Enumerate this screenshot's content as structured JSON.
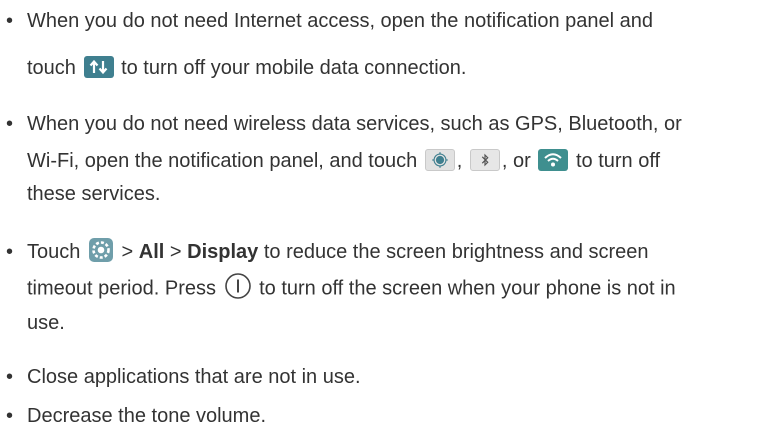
{
  "tips": [
    {
      "line1": "When you do not need Internet access, open the notification panel and",
      "line2_before": "touch",
      "line2_after": "to turn off your mobile data connection."
    },
    {
      "line1": "When you do not need wireless data services, such as GPS, Bluetooth, or",
      "line2_before": "Wi-Fi, open the notification panel, and touch",
      "line2_sep1": ",",
      "line2_sep2": ", or",
      "line2_after": "to turn off",
      "line3": "these services."
    },
    {
      "line1_before": "Touch",
      "line1_sep1": ">",
      "line1_all": "All",
      "line1_sep2": ">",
      "line1_display": "Display",
      "line1_after": "to reduce the screen brightness and screen",
      "line2_before": "timeout period. Press",
      "line2_after": "to turn off the screen when your phone is not in",
      "line3": "use."
    },
    {
      "line1": "Close applications that are not in use."
    },
    {
      "line1": "Decrease the tone volume."
    }
  ],
  "bullet_char": "•",
  "icons": {
    "mobile_data": "mobile-data-toggle-icon",
    "gps": "gps-toggle-icon",
    "bluetooth": "bluetooth-toggle-icon",
    "wifi": "wifi-toggle-icon",
    "settings": "settings-gear-icon",
    "power": "power-key-icon"
  },
  "colors": {
    "text": "#333333",
    "data_icon_bg": "#3f7f8f",
    "wifi_icon_bg": "#3f8f8f",
    "tile_bg": "#e7e7e7"
  }
}
